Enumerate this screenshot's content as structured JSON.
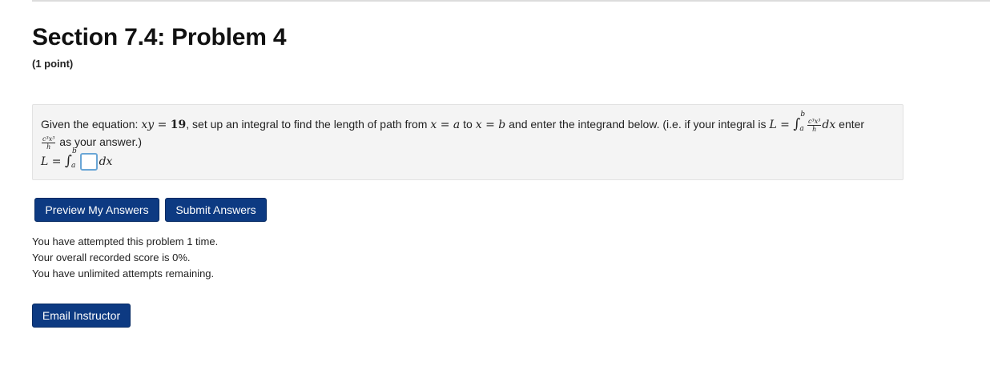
{
  "page": {
    "title": "Section 7.4: Problem 4",
    "points": "(1 point)"
  },
  "problem": {
    "text1": "Given the equation: ",
    "eq_lhs": "xy",
    "eq_eq": " = ",
    "eq_rhs": "19",
    "text2": ", set up an integral to find the length of path from ",
    "x1": "x",
    "eq2": " = ",
    "a1": "a",
    "to": " to ",
    "x2": "x",
    "eq3": " = ",
    "b1": "b",
    "text3": " and enter the integrand below. (i.e. if your integral is ",
    "L1": "L",
    "eq4": " = ",
    "int_sign": "∫",
    "lim_upper": "b",
    "lim_lower": "a",
    "frac_num": "c³x³",
    "frac_den": "h",
    "dx1": "dx",
    "text4": " enter",
    "as_your_answer": " as your answer.)",
    "L2": "L",
    "eq5": " = ",
    "dx2": "dx"
  },
  "buttons": {
    "preview": "Preview My Answers",
    "submit": "Submit Answers",
    "email": "Email Instructor"
  },
  "status": {
    "attempts": "You have attempted this problem 1 time.",
    "score": "Your overall recorded score is 0%.",
    "remaining": "You have unlimited attempts remaining."
  },
  "answer": {
    "value": ""
  }
}
